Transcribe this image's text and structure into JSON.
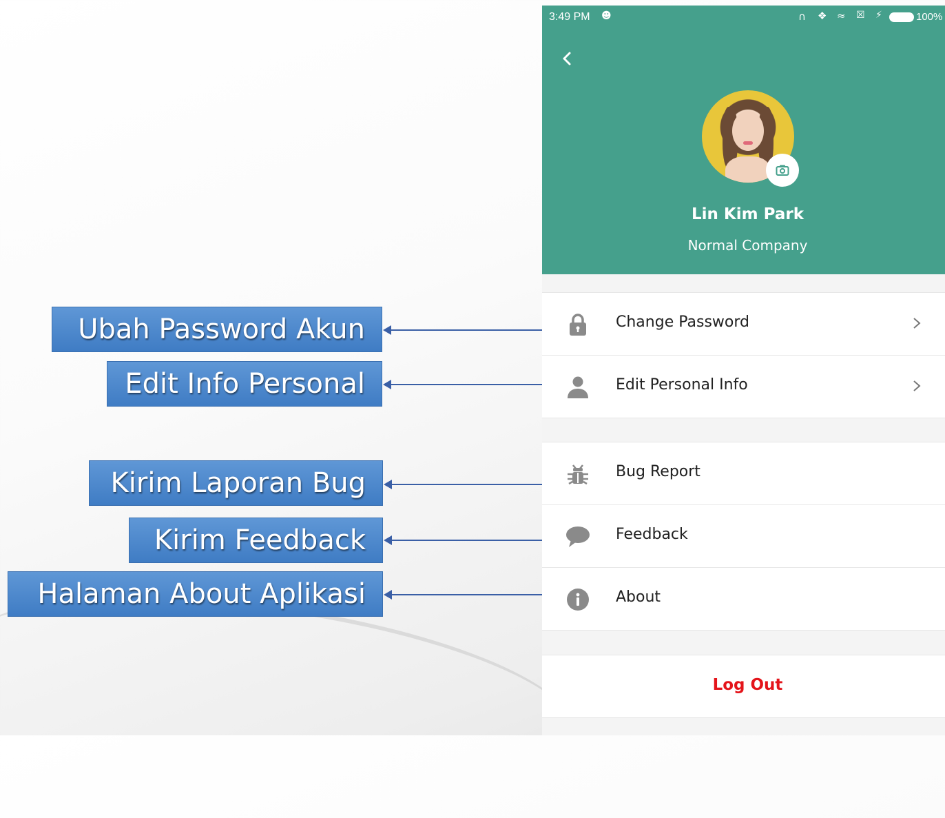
{
  "annotations": [
    {
      "label": "Ubah Password Akun"
    },
    {
      "label": "Edit Info Personal"
    },
    {
      "label": "Kirim Laporan Bug"
    },
    {
      "label": "Kirim Feedback"
    },
    {
      "label": "Halaman About Aplikasi"
    }
  ],
  "status_bar": {
    "time": "3:49 PM",
    "battery": "100%"
  },
  "profile": {
    "name": "Lin Kim Park",
    "company": "Normal Company"
  },
  "menu": {
    "account": [
      {
        "label": "Change Password",
        "icon": "lock-icon"
      },
      {
        "label": "Edit Personal Info",
        "icon": "person-icon"
      }
    ],
    "support": [
      {
        "label": "Bug Report",
        "icon": "bug-icon"
      },
      {
        "label": "Feedback",
        "icon": "chat-bubble-icon"
      },
      {
        "label": "About",
        "icon": "info-icon"
      }
    ]
  },
  "logout_label": "Log Out",
  "colors": {
    "header": "#45a08c",
    "logout": "#e4141a",
    "callout": "#4a86c8",
    "icon": "#8a8a8a"
  }
}
